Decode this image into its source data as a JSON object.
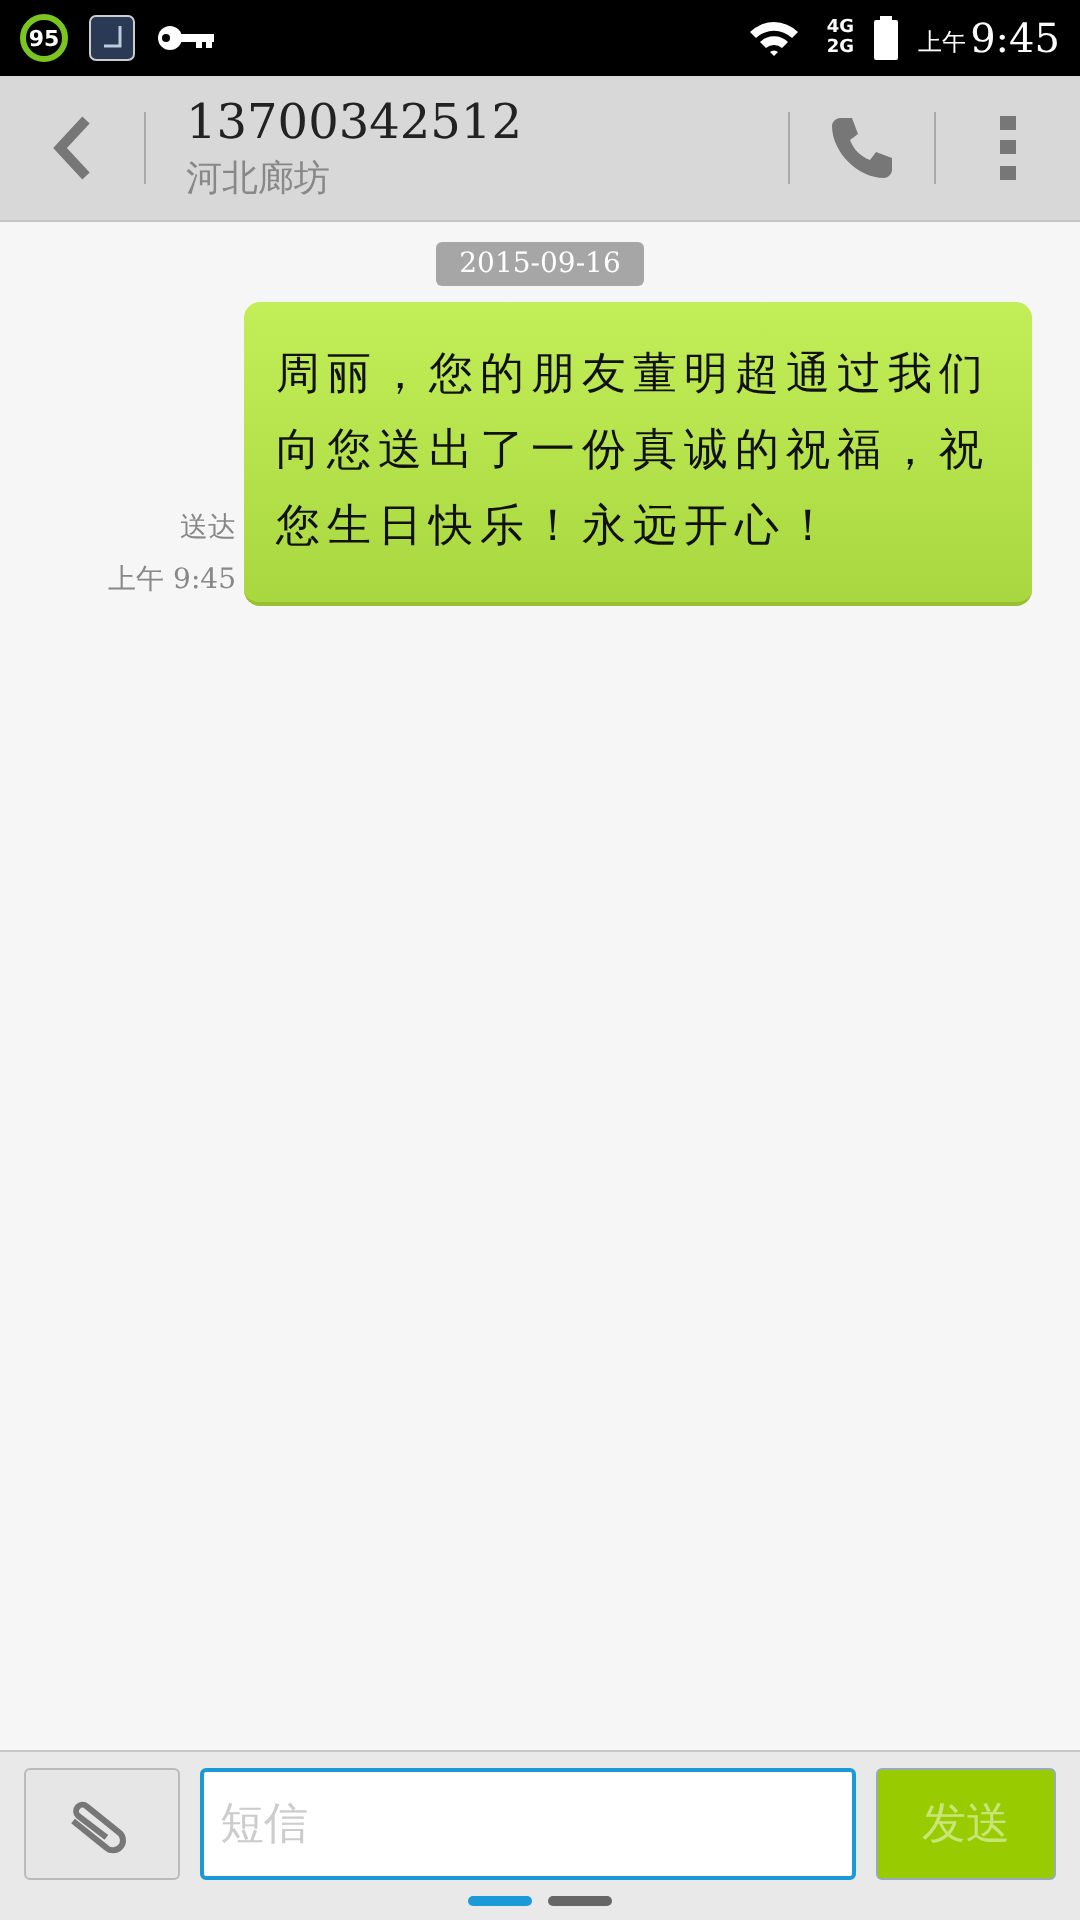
{
  "status_bar": {
    "battery_ring": "95",
    "network_1": "4G",
    "network_2": "2G",
    "time_prefix": "上午",
    "time": "9:45"
  },
  "header": {
    "title": "13700342512",
    "subtitle": "河北廊坊"
  },
  "conversation": {
    "date": "2015-09-16",
    "messages": [
      {
        "text": "周丽，您的朋友董明超通过我们向您送出了一份真诚的祝福，祝您生日快乐！永远开心！",
        "status": "送达",
        "time": "上午 9:45"
      }
    ]
  },
  "composer": {
    "placeholder": "短信",
    "send": "发送"
  },
  "pages": [
    {
      "selected": true
    },
    {
      "selected": false
    }
  ]
}
